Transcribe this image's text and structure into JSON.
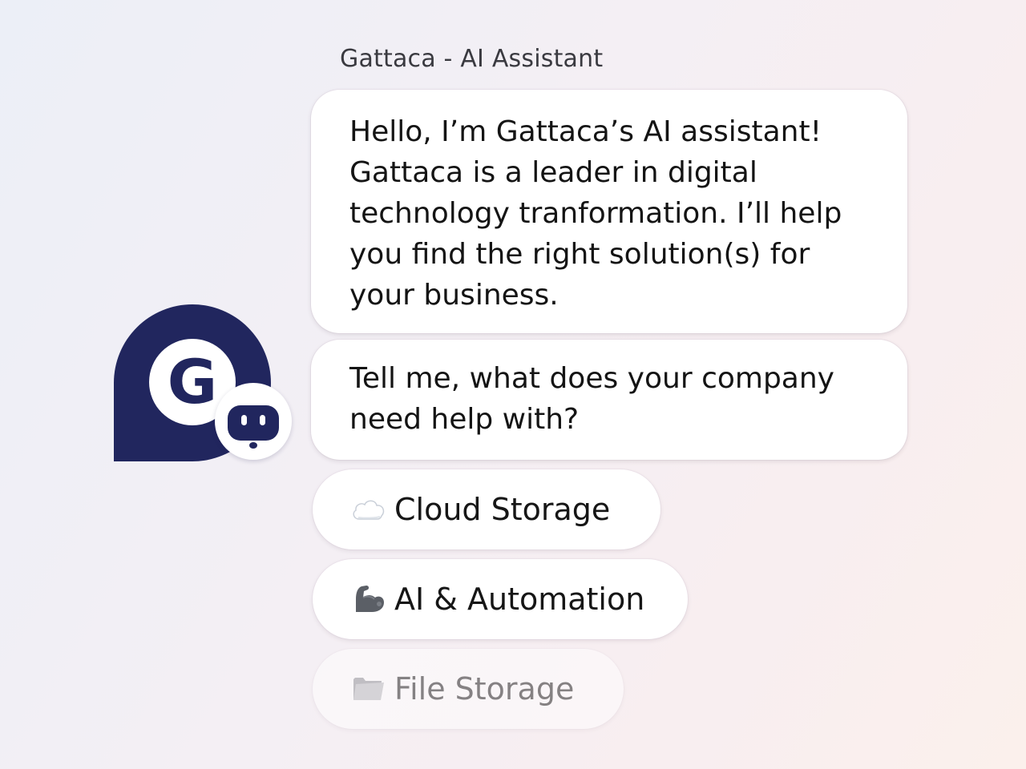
{
  "header": {
    "sender_name": "Gattaca - AI Assistant"
  },
  "avatar": {
    "letter": "G",
    "icon": "bot-icon",
    "color": "#21265e"
  },
  "messages": [
    {
      "text": "Hello, I’m Gattaca’s AI assistant! Gattaca is a leader in digital technology tranformation. I’ll help you find the right solution(s) for your business."
    },
    {
      "text": "Tell me, what does your company need help with?"
    }
  ],
  "options": [
    {
      "icon": "cloud-icon",
      "label": "Cloud Storage"
    },
    {
      "icon": "flexed-biceps-icon",
      "label": "AI & Automation"
    },
    {
      "icon": "folder-icon",
      "label": "File Storage"
    }
  ]
}
